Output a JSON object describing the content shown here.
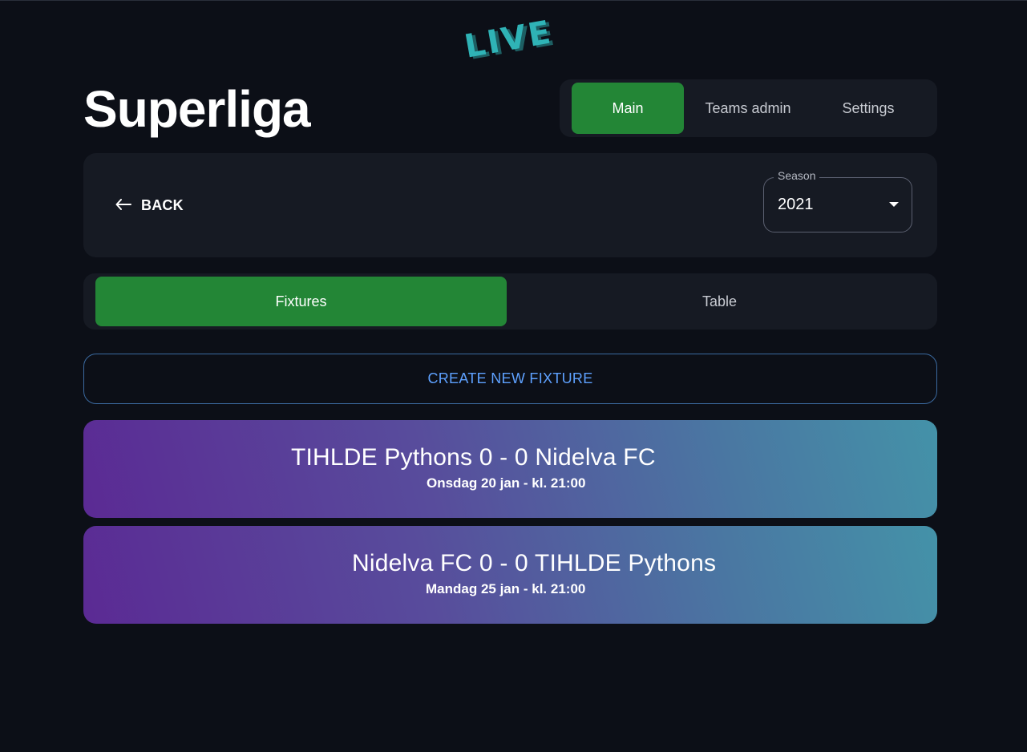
{
  "app": {
    "logo_text": "LIVE"
  },
  "page": {
    "title": "Superliga"
  },
  "nav": {
    "tabs": [
      {
        "label": "Main",
        "active": true
      },
      {
        "label": "Teams admin",
        "active": false
      },
      {
        "label": "Settings",
        "active": false
      }
    ]
  },
  "toolbar": {
    "back_label": "BACK",
    "back_icon": "arrow-left-icon",
    "season": {
      "label": "Season",
      "value": "2021"
    }
  },
  "view_tabs": [
    {
      "label": "Fixtures",
      "active": true
    },
    {
      "label": "Table",
      "active": false
    }
  ],
  "create_fixture_label": "CREATE NEW FIXTURE",
  "fixtures": [
    {
      "title": "TIHLDE Pythons 0 - 0 Nidelva FC",
      "date": "Onsdag 20 jan - kl. 21:00"
    },
    {
      "title": "Nidelva FC 0 - 0 TIHLDE Pythons",
      "date": "Mandag 25 jan - kl. 21:00"
    }
  ],
  "colors": {
    "background": "#0c0f17",
    "card": "#161a23",
    "accent_green": "#238636",
    "link_blue": "#5ea1ff",
    "logo_teal": "#2fb3b6"
  }
}
